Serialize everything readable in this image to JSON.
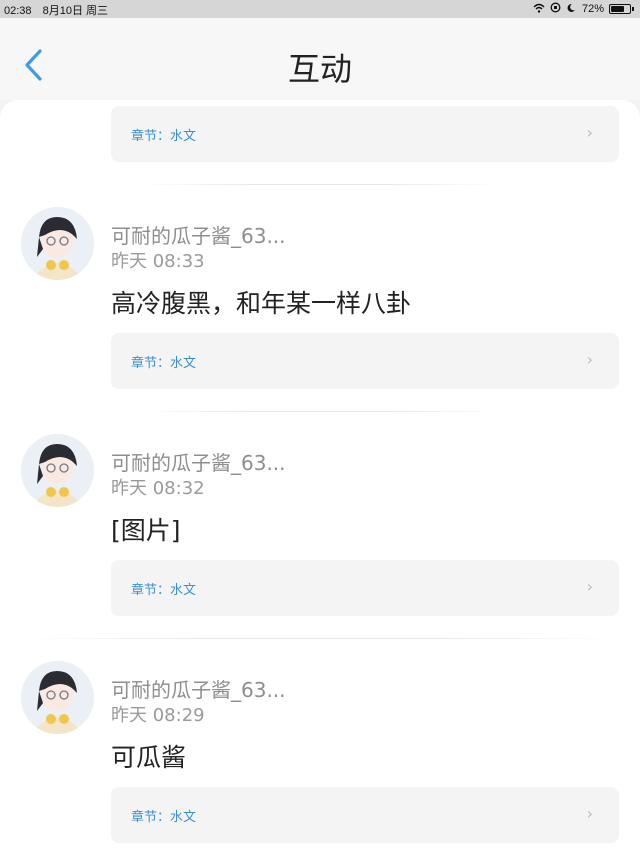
{
  "status_bar": {
    "time": "02:38",
    "date": "8月10日 周三",
    "battery": "72%",
    "battery_level": 0.72,
    "icons": [
      "wifi-icon",
      "orientation-lock-icon",
      "moon-icon",
      "battery-icon"
    ]
  },
  "header": {
    "title": "互动",
    "back_icon": "chevron-left-icon"
  },
  "colors": {
    "accent": "#3a8fd6",
    "title": "#222222",
    "secondary": "#8e8e8e"
  },
  "top_card": {
    "chapter": "章节：水文"
  },
  "comments": [
    {
      "user": "可耐的瓜子酱_63...",
      "time": "昨天 08:33",
      "text": "高冷腹黑，和年某一样八卦",
      "chapter": "章节：水文"
    },
    {
      "user": "可耐的瓜子酱_63...",
      "time": "昨天 08:32",
      "text": "[图片]",
      "chapter": "章节：水文"
    },
    {
      "user": "可耐的瓜子酱_63...",
      "time": "昨天 08:29",
      "text": "可瓜酱",
      "chapter": "章节：水文"
    }
  ]
}
